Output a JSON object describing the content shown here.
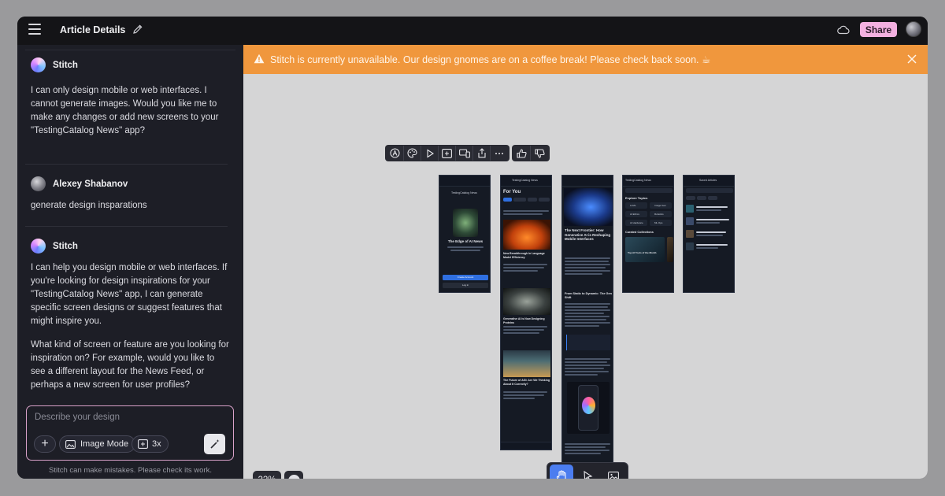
{
  "header": {
    "title": "Article Details",
    "share_label": "Share"
  },
  "chat": {
    "messages": [
      {
        "author": "Stitch",
        "text": "I can only design mobile or web interfaces. I cannot generate images. Would you like me to make any changes or add new screens to your \"TestingCatalog News\" app?"
      },
      {
        "author": "Alexey Shabanov",
        "text": "generate design insparations"
      },
      {
        "author": "Stitch",
        "text": "I can help you design mobile or web interfaces. If you're looking for design inspirations for your \"TestingCatalog News\" app, I can generate specific screen designs or suggest features that might inspire you."
      }
    ],
    "followup": "What kind of screen or feature are you looking for inspiration on? For example, would you like to see a different layout for the News Feed, or perhaps a new screen for user profiles?"
  },
  "composer": {
    "placeholder": "Describe your design",
    "image_mode_label": "Image Mode",
    "variants_label": "3x"
  },
  "disclaimer": "Stitch can make mistakes. Please check its work.",
  "banner": {
    "text": "Stitch is currently unavailable. Our design gnomes are on a coffee break! Please check back soon. ☕"
  },
  "canvas": {
    "zoom": "22%",
    "screens": [
      {
        "app": "TestingCatalog News",
        "heading": "The Edge of AI News",
        "primary": "Create Account",
        "secondary": "Log in"
      },
      {
        "app": "TestingCatalog News",
        "heading": "For You",
        "items": [
          "New Breakthrough in Language Model Efficiency",
          "Generative AI is Now Designing Proteins",
          "The Future of AGI: Are We Thinking About It Correctly?"
        ]
      },
      {
        "app": "",
        "heading": "The Next Frontier: How Generative AI is Reshaping Mobile Interfaces",
        "subheading": "From Static to Dynamic: The Gen Shift"
      },
      {
        "app": "TestingCatalog News",
        "heading": "Explore Topics",
        "topics": [
          "LLMs",
          "AI Ethics",
          "AI Hardware",
          "Image Gen",
          "Robotics",
          "ML Ops"
        ],
        "subheading": "Curated Collections",
        "collection": "Top AI Tools of the Month"
      },
      {
        "app": "Saved Articles",
        "heading": "Saved Articles"
      }
    ]
  },
  "colors": {
    "banner": "#f0973d",
    "share": "#f3b0e0",
    "composer_border": "#d9a2c9",
    "active_tool": "#4b7df0"
  }
}
